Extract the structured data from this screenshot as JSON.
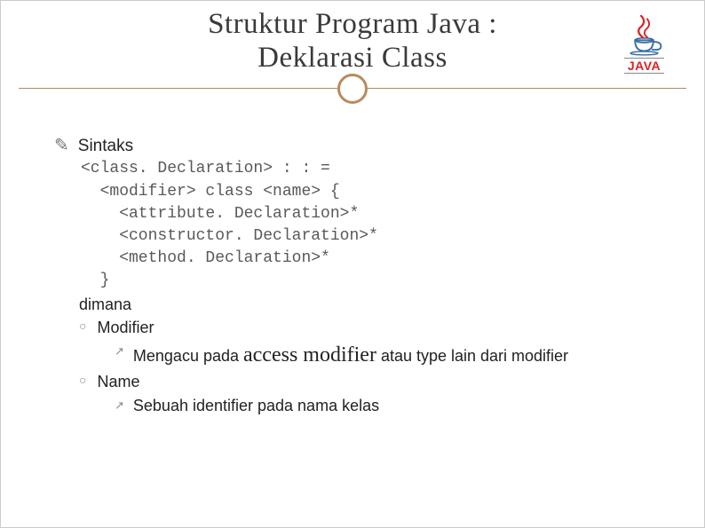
{
  "title": {
    "line1": "Struktur Program Java :",
    "line2": "Deklarasi Class"
  },
  "logo": {
    "text": "JAVA"
  },
  "content": {
    "sintaks_label": "Sintaks",
    "code": {
      "l1": "<class. Declaration> : : =",
      "l2": "  <modifier> class <name> {",
      "l3": "    <attribute. Declaration>*",
      "l4": "    <constructor. Declaration>*",
      "l5": "    <method. Declaration>*",
      "l6": "  }"
    },
    "dimana": "dimana",
    "modifier": {
      "label": "Modifier",
      "desc_pre": "Mengacu pada ",
      "desc_emph": "access modifier",
      "desc_post": " atau type lain dari modifier"
    },
    "name": {
      "label": "Name",
      "desc": "Sebuah identifier pada nama kelas"
    }
  }
}
